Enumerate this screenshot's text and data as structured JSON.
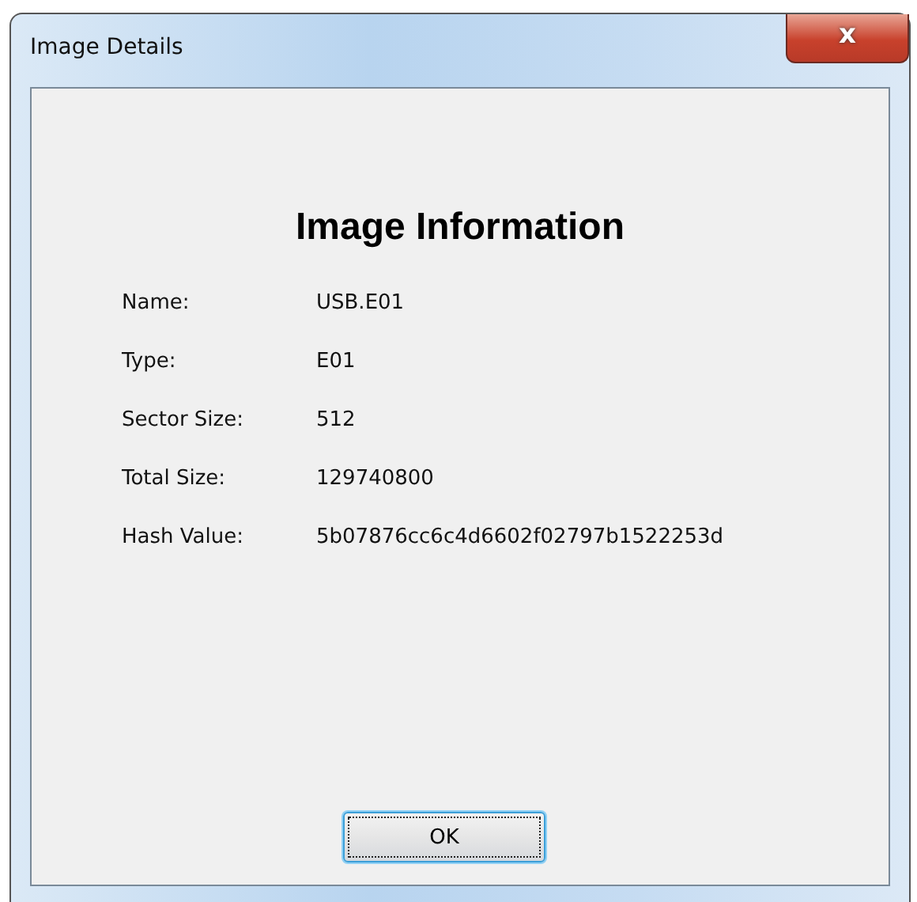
{
  "window": {
    "title": "Image Details",
    "close": "x"
  },
  "heading": "Image Information",
  "fields": [
    {
      "label": "Name:",
      "value": "USB.E01"
    },
    {
      "label": "Type:",
      "value": "E01"
    },
    {
      "label": "Sector Size:",
      "value": "512"
    },
    {
      "label": "Total Size:",
      "value": "129740800"
    },
    {
      "label": "Hash Value:",
      "value": "5b07876cc6c4d6602f02797b1522253d"
    }
  ],
  "buttons": [
    {
      "label": "OK",
      "focused": true
    }
  ]
}
